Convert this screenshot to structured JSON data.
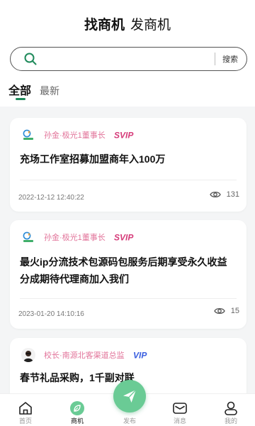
{
  "header": {
    "tab_active": "找商机",
    "tab_inactive": "发商机"
  },
  "search": {
    "placeholder": "",
    "button_label": "搜索"
  },
  "filter": {
    "all": "全部",
    "latest": "最新"
  },
  "posts": [
    {
      "author": "孙金·极光1董事长",
      "badge": "SVIP",
      "title": "充场工作室招募加盟商年入100万",
      "time": "2022-12-12 12:40:22",
      "views": "131"
    },
    {
      "author": "孙金·极光1董事长",
      "badge": "SVIP",
      "title": "最火ip分流技术包源码包服务后期享受永久收益分成期待代理商加入我们",
      "time": "2023-01-20 14:10:16",
      "views": "15"
    },
    {
      "author": "校长·南源北客渠道总监",
      "badge": "VIP",
      "title": "春节礼品采购，1千副对联"
    }
  ],
  "nav": {
    "home": "首页",
    "opportunity": "商机",
    "publish": "发布",
    "messages": "消息",
    "mine": "我的"
  },
  "colors": {
    "accent": "#1f8a5b",
    "fab": "#6acb95",
    "author_pink": "#e2749a",
    "svip": "#d63c7a",
    "vip": "#3a5fe0"
  },
  "icons": {
    "search": "search-icon",
    "eye": "eye-icon",
    "send": "paper-plane-icon",
    "home": "home-icon",
    "opportunity": "leaf-icon",
    "messages": "envelope-icon",
    "mine": "person-icon"
  }
}
